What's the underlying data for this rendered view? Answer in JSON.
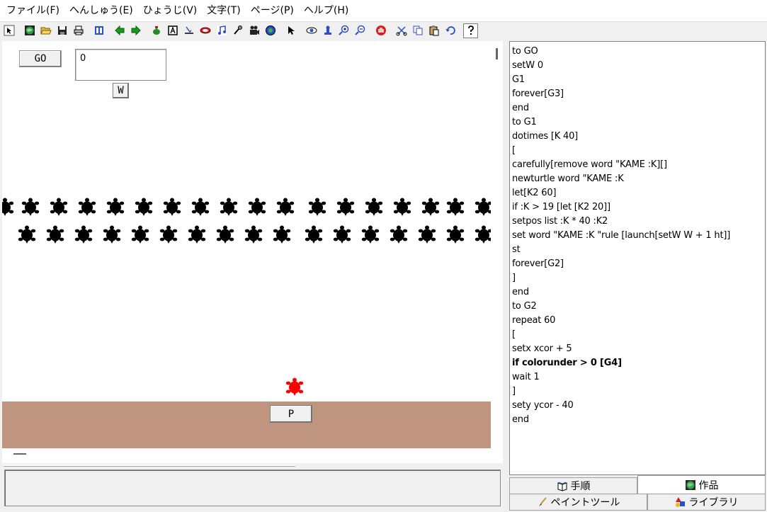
{
  "menu": [
    {
      "label": "ファイル(F)",
      "name": "menu-file"
    },
    {
      "label": "へんしゅう(E)",
      "name": "menu-edit"
    },
    {
      "label": "ひょうじ(V)",
      "name": "menu-view"
    },
    {
      "label": "文字(T)",
      "name": "menu-text"
    },
    {
      "label": "ページ(P)",
      "name": "menu-page"
    },
    {
      "label": "ヘルプ(H)",
      "name": "menu-help"
    }
  ],
  "toolbar": {
    "icons": [
      "cursor-arrow-icon",
      "separator",
      "globe-icon",
      "open-folder-icon",
      "save-disk-icon",
      "print-icon",
      "separator",
      "pages-icon",
      "separator",
      "arrow-left-icon",
      "arrow-right-icon",
      "separator",
      "new-turtle-icon",
      "text-box-icon",
      "slider-icon",
      "button-shape-icon",
      "music-note-icon",
      "sound-icon",
      "movie-icon",
      "record-icon",
      "separator",
      "pointer-icon",
      "separator",
      "eye-icon",
      "stamp-icon",
      "zoom-in-icon",
      "zoom-out-icon",
      "separator",
      "stop-hand-icon",
      "separator",
      "cut-icon",
      "copy-icon",
      "paste-icon",
      "undo-icon",
      "separator",
      "help-question-icon"
    ]
  },
  "stage": {
    "go_button": "GO",
    "textbox_value": "0",
    "w_button": "W",
    "p_button": "P",
    "colors": {
      "turtle": "#000000",
      "active_turtle": "#ff0000",
      "ground": "#bf9580"
    }
  },
  "code": [
    {
      "text": "to GO"
    },
    {
      "text": "setW 0"
    },
    {
      "text": "G1"
    },
    {
      "text": "forever[G3]"
    },
    {
      "text": "end"
    },
    {
      "text": "to G1"
    },
    {
      "text": "dotimes [K 40]"
    },
    {
      "text": "["
    },
    {
      "text": "carefully[remove word \"KAME :K][]"
    },
    {
      "text": "newturtle word \"KAME :K"
    },
    {
      "text": "let[K2 60]"
    },
    {
      "text": "if :K > 19 [let [K2 20]]"
    },
    {
      "text": "setpos list :K * 40 :K2"
    },
    {
      "text": "set word \"KAME :K \"rule [launch[setW W + 1 ht]]"
    },
    {
      "text": "st"
    },
    {
      "text": "forever[G2]"
    },
    {
      "text": "]"
    },
    {
      "text": "end"
    },
    {
      "text": "to G2"
    },
    {
      "text": "repeat 60"
    },
    {
      "text": "["
    },
    {
      "text": "setx xcor + 5"
    },
    {
      "text": "if colorunder > 0 [G4]",
      "bold": true
    },
    {
      "text": "wait 1"
    },
    {
      "text": "]"
    },
    {
      "text": "sety ycor - 40"
    },
    {
      "text": "end"
    }
  ],
  "tabs": {
    "procedures": "手順",
    "project": "作品",
    "paint_tools": "ペイントツール",
    "library": "ライブラリ"
  }
}
